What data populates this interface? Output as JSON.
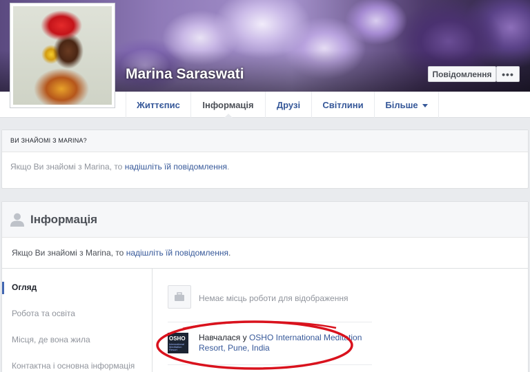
{
  "profile": {
    "name": "Marina Saraswati",
    "message_button": "Повідомлення",
    "more_button": "•••"
  },
  "nav": {
    "tabs": [
      {
        "label": "Життєпис"
      },
      {
        "label": "Інформація"
      },
      {
        "label": "Друзі"
      },
      {
        "label": "Світлини"
      },
      {
        "label": "Більше"
      }
    ],
    "active": "Інформація"
  },
  "know_card": {
    "heading": "ВИ ЗНАЙОМІ З MARINA?",
    "text_before": "Якщо Ви знайомі з Marina, то ",
    "link": "надішліть їй повідомлення",
    "text_after": "."
  },
  "about": {
    "title": "Інформація",
    "notice_before": "Якщо Ви знайомі з Marina, то ",
    "notice_link": "надішліть їй повідомлення",
    "notice_after": ".",
    "sidebar": [
      {
        "label": "Огляд"
      },
      {
        "label": "Робота та освіта"
      },
      {
        "label": "Місця, де вона жила"
      },
      {
        "label": "Контактна і основна інформація"
      }
    ],
    "work_text": "Немає місць роботи для відображення",
    "education_prefix": "Навчалася у ",
    "education_link": "OSHO International Meditation Resort, Pune, India",
    "logo_text_big": "OSHO",
    "logo_text_small": "International Meditation Resort"
  },
  "colors": {
    "link": "#365899",
    "annotation": "#d9121d"
  }
}
